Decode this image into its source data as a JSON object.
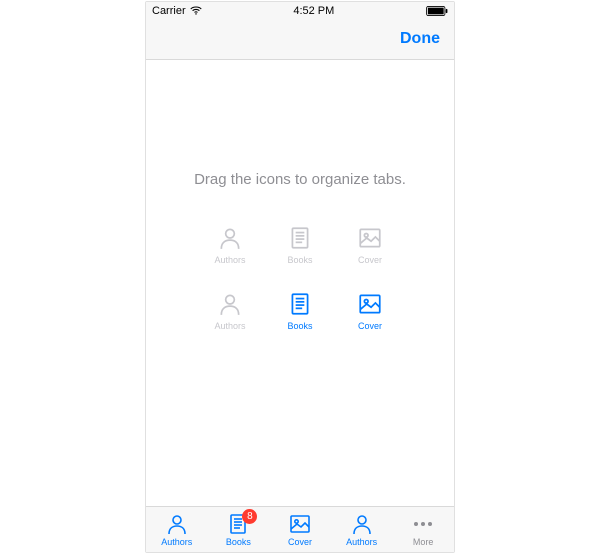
{
  "status": {
    "carrier": "Carrier",
    "time": "4:52 PM"
  },
  "nav": {
    "done_label": "Done"
  },
  "instruction": "Drag the icons to organize tabs.",
  "grid": {
    "row1": [
      {
        "label": "Authors",
        "icon": "person",
        "state": "disabled"
      },
      {
        "label": "Books",
        "icon": "book",
        "state": "disabled"
      },
      {
        "label": "Cover",
        "icon": "image",
        "state": "disabled"
      }
    ],
    "row2": [
      {
        "label": "Authors",
        "icon": "person",
        "state": "disabled"
      },
      {
        "label": "Books",
        "icon": "book",
        "state": "enabled"
      },
      {
        "label": "Cover",
        "icon": "image",
        "state": "enabled"
      }
    ]
  },
  "tab_bar": [
    {
      "label": "Authors",
      "icon": "person",
      "badge": null
    },
    {
      "label": "Books",
      "icon": "book",
      "badge": "8"
    },
    {
      "label": "Cover",
      "icon": "image",
      "badge": null
    },
    {
      "label": "Authors",
      "icon": "person",
      "badge": null
    },
    {
      "label": "More",
      "icon": "more",
      "badge": null
    }
  ]
}
